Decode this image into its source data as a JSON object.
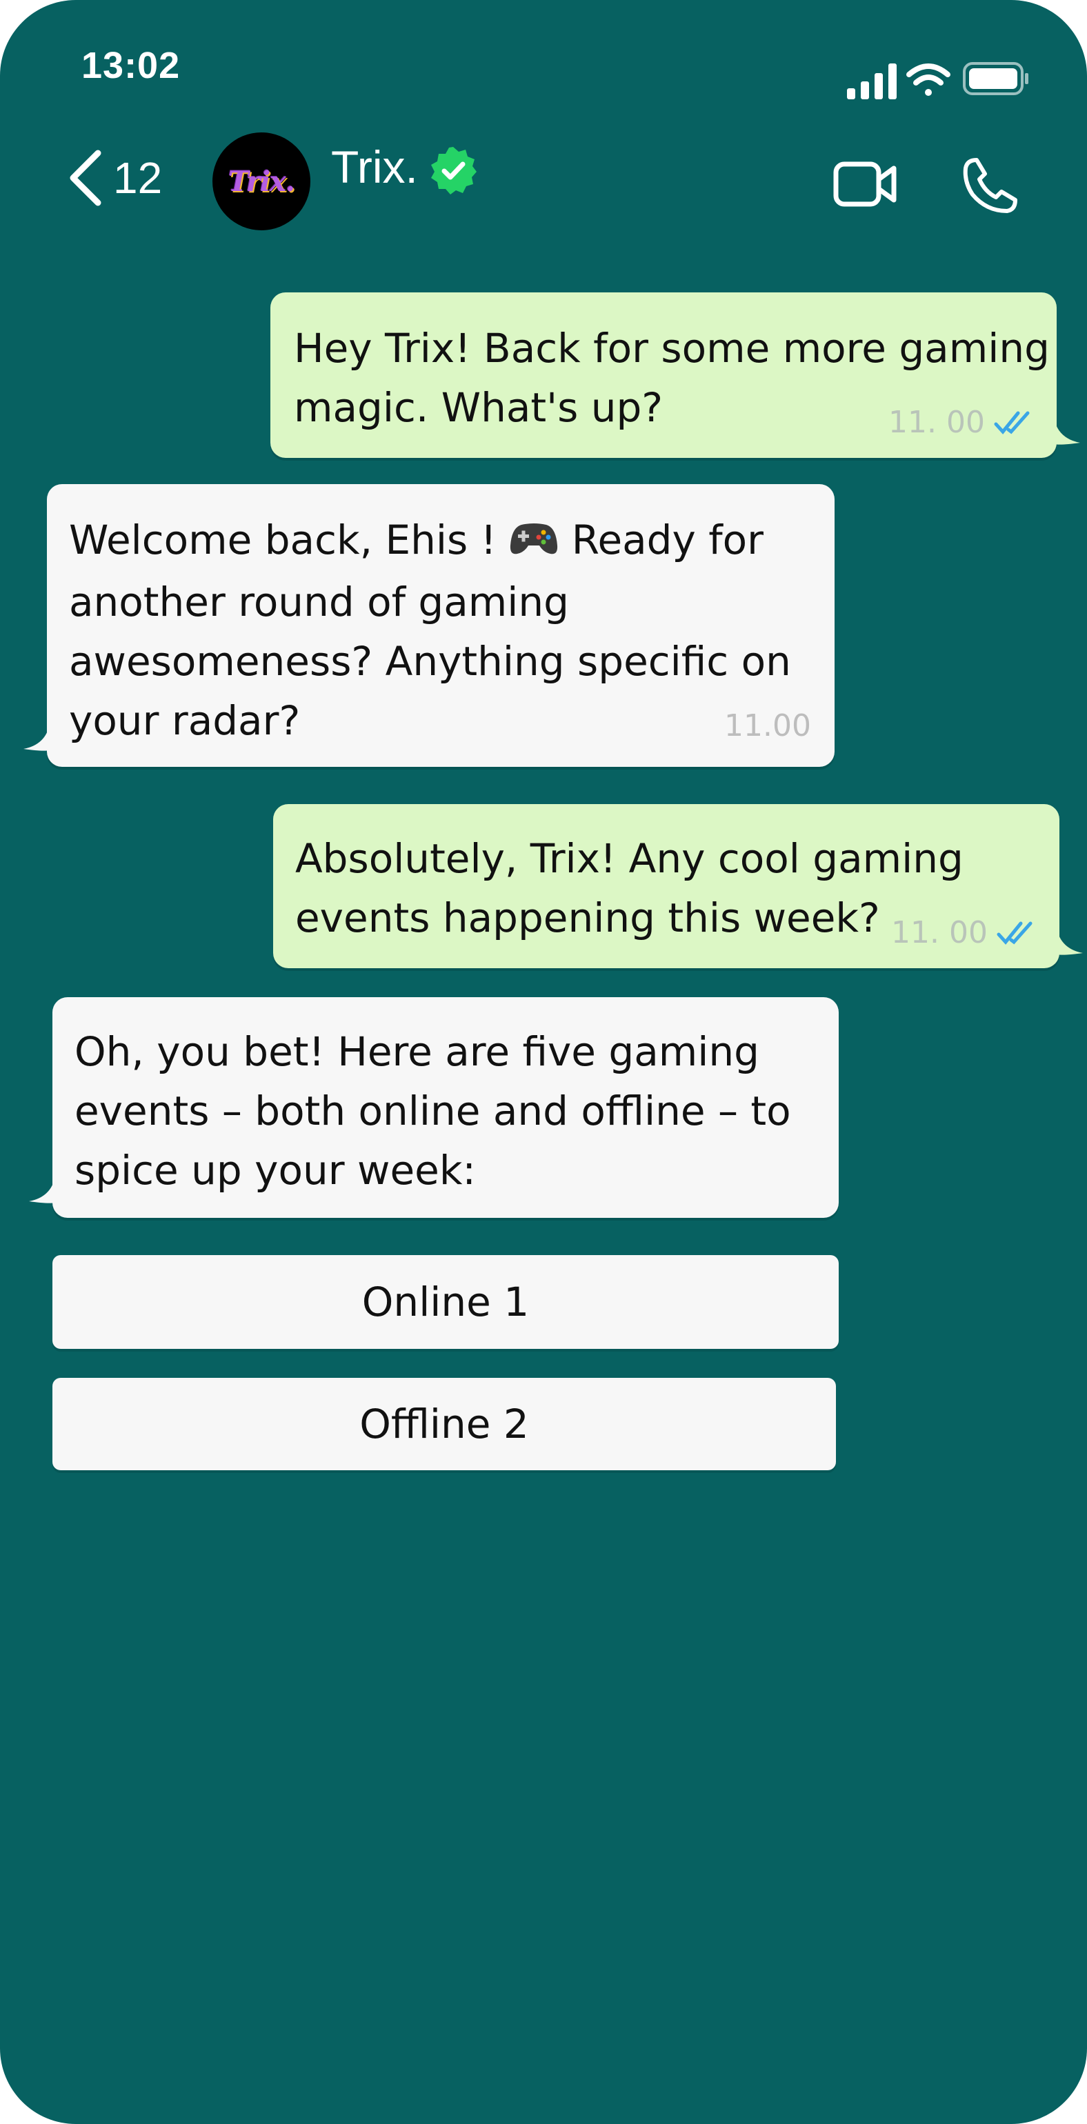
{
  "status_bar": {
    "time": "13:02",
    "icons": [
      "signal-icon",
      "wifi-icon",
      "battery-icon"
    ]
  },
  "header": {
    "back_count": "12",
    "avatar_text": "Trix.",
    "contact_name": "Trix.",
    "verified": true,
    "actions": [
      "video-call-icon",
      "phone-call-icon"
    ]
  },
  "messages": [
    {
      "direction": "out",
      "lines": [
        "Hey Trix! Back for some more gaming",
        "magic. What's up?"
      ],
      "time": "11. 00",
      "ticks": "read"
    },
    {
      "direction": "in",
      "lines": [
        "Welcome back, Ehis ! ",
        "another round of gaming",
        "awesomeness? Anything specific on",
        "your radar?"
      ],
      "line1_suffix": " Ready for",
      "emoji": "game-controller-icon",
      "time": "11.00"
    },
    {
      "direction": "out",
      "lines": [
        "Absolutely, Trix! Any cool gaming",
        "events happening this week?"
      ],
      "time": "11. 00",
      "ticks": "read"
    },
    {
      "direction": "in",
      "lines": [
        "Oh, you bet! Here are five gaming",
        "events – both online and offline – to",
        "spice up your week:"
      ]
    }
  ],
  "quick_replies": [
    "Online 1",
    "Offline 2"
  ],
  "colors": {
    "background": "#076161",
    "outgoing": "#dcf7c5",
    "incoming": "#f7f7f7",
    "read_ticks": "#3aa6e6",
    "verified": "#25d366"
  }
}
